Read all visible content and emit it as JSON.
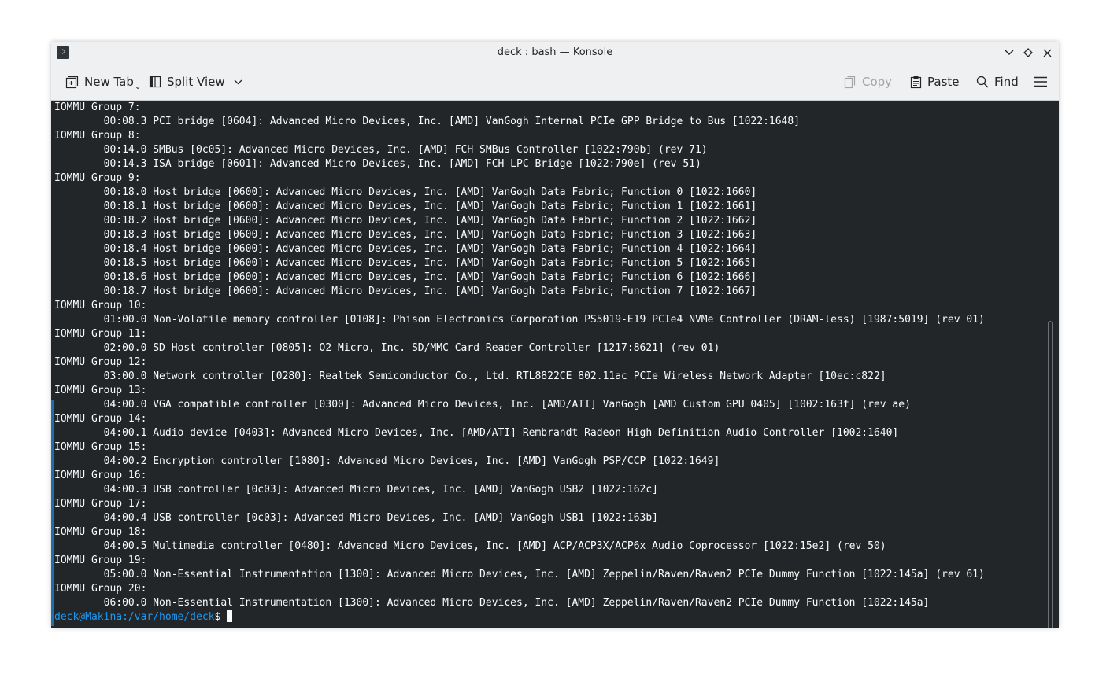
{
  "window": {
    "title": "deck : bash — Konsole"
  },
  "toolbar": {
    "new_tab_label": "New Tab",
    "split_view_label": "Split View",
    "copy_label": "Copy",
    "paste_label": "Paste",
    "find_label": "Find"
  },
  "icons": {
    "app": "konsole-icon",
    "minimize": "chevron-down-icon",
    "maximize": "diamond-icon",
    "close": "close-icon",
    "new_tab": "new-tab-icon",
    "split_view": "split-view-icon",
    "copy": "copy-icon",
    "paste": "paste-icon",
    "find": "search-icon",
    "menu": "hamburger-menu-icon"
  },
  "colors": {
    "terminal_bg": "#232629",
    "terminal_fg": "#fcfcfc",
    "prompt": "#1d99f3",
    "chrome_bg": "#eff0f1"
  },
  "terminal": {
    "lines": [
      "IOMMU Group 7:",
      "        00:08.3 PCI bridge [0604]: Advanced Micro Devices, Inc. [AMD] VanGogh Internal PCIe GPP Bridge to Bus [1022:1648]",
      "IOMMU Group 8:",
      "        00:14.0 SMBus [0c05]: Advanced Micro Devices, Inc. [AMD] FCH SMBus Controller [1022:790b] (rev 71)",
      "        00:14.3 ISA bridge [0601]: Advanced Micro Devices, Inc. [AMD] FCH LPC Bridge [1022:790e] (rev 51)",
      "IOMMU Group 9:",
      "        00:18.0 Host bridge [0600]: Advanced Micro Devices, Inc. [AMD] VanGogh Data Fabric; Function 0 [1022:1660]",
      "        00:18.1 Host bridge [0600]: Advanced Micro Devices, Inc. [AMD] VanGogh Data Fabric; Function 1 [1022:1661]",
      "        00:18.2 Host bridge [0600]: Advanced Micro Devices, Inc. [AMD] VanGogh Data Fabric; Function 2 [1022:1662]",
      "        00:18.3 Host bridge [0600]: Advanced Micro Devices, Inc. [AMD] VanGogh Data Fabric; Function 3 [1022:1663]",
      "        00:18.4 Host bridge [0600]: Advanced Micro Devices, Inc. [AMD] VanGogh Data Fabric; Function 4 [1022:1664]",
      "        00:18.5 Host bridge [0600]: Advanced Micro Devices, Inc. [AMD] VanGogh Data Fabric; Function 5 [1022:1665]",
      "        00:18.6 Host bridge [0600]: Advanced Micro Devices, Inc. [AMD] VanGogh Data Fabric; Function 6 [1022:1666]",
      "        00:18.7 Host bridge [0600]: Advanced Micro Devices, Inc. [AMD] VanGogh Data Fabric; Function 7 [1022:1667]",
      "IOMMU Group 10:",
      "        01:00.0 Non-Volatile memory controller [0108]: Phison Electronics Corporation PS5019-E19 PCIe4 NVMe Controller (DRAM-less) [1987:5019] (rev 01)",
      "IOMMU Group 11:",
      "        02:00.0 SD Host controller [0805]: O2 Micro, Inc. SD/MMC Card Reader Controller [1217:8621] (rev 01)",
      "IOMMU Group 12:",
      "        03:00.0 Network controller [0280]: Realtek Semiconductor Co., Ltd. RTL8822CE 802.11ac PCIe Wireless Network Adapter [10ec:c822]",
      "IOMMU Group 13:",
      "        04:00.0 VGA compatible controller [0300]: Advanced Micro Devices, Inc. [AMD/ATI] VanGogh [AMD Custom GPU 0405] [1002:163f] (rev ae)",
      "IOMMU Group 14:",
      "        04:00.1 Audio device [0403]: Advanced Micro Devices, Inc. [AMD/ATI] Rembrandt Radeon High Definition Audio Controller [1002:1640]",
      "IOMMU Group 15:",
      "        04:00.2 Encryption controller [1080]: Advanced Micro Devices, Inc. [AMD] VanGogh PSP/CCP [1022:1649]",
      "IOMMU Group 16:",
      "        04:00.3 USB controller [0c03]: Advanced Micro Devices, Inc. [AMD] VanGogh USB2 [1022:162c]",
      "IOMMU Group 17:",
      "        04:00.4 USB controller [0c03]: Advanced Micro Devices, Inc. [AMD] VanGogh USB1 [1022:163b]",
      "IOMMU Group 18:",
      "        04:00.5 Multimedia controller [0480]: Advanced Micro Devices, Inc. [AMD] ACP/ACP3X/ACP6x Audio Coprocessor [1022:15e2] (rev 50)",
      "IOMMU Group 19:",
      "        05:00.0 Non-Essential Instrumentation [1300]: Advanced Micro Devices, Inc. [AMD] Zeppelin/Raven/Raven2 PCIe Dummy Function [1022:145a] (rev 61)",
      "IOMMU Group 20:",
      "        06:00.0 Non-Essential Instrumentation [1300]: Advanced Micro Devices, Inc. [AMD] Zeppelin/Raven/Raven2 PCIe Dummy Function [1022:145a]"
    ],
    "prompt": "deck@Makina:/var/home/deck",
    "prompt_symbol": "$"
  }
}
